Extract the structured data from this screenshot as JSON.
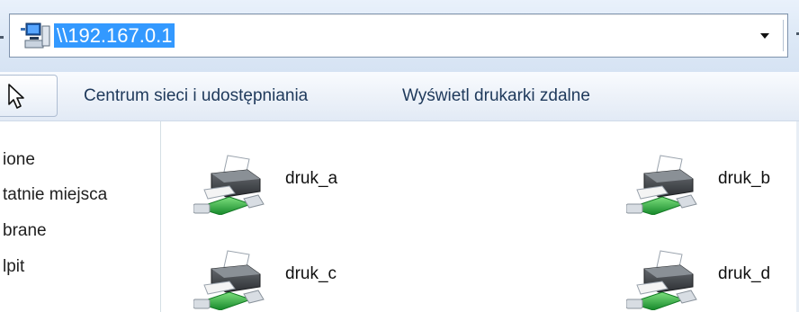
{
  "address_bar": {
    "path": "\\\\192.167.0.1",
    "location_icon": "computer-icon",
    "dropdown_icon": "chevron-down-icon"
  },
  "command_bar": {
    "tool_icon": "cursor-arrow-icon",
    "items": [
      {
        "label": "Centrum sieci i udostępniania"
      },
      {
        "label": "Wyświetl drukarki zdalne"
      }
    ]
  },
  "nav_pane": {
    "items": [
      {
        "label": "ione"
      },
      {
        "label": "tatnie miejsca"
      },
      {
        "label": "brane"
      },
      {
        "label": "lpit"
      }
    ]
  },
  "content": {
    "printers": [
      {
        "name": "druk_a",
        "icon": "network-printer-icon"
      },
      {
        "name": "druk_b",
        "icon": "network-printer-icon"
      },
      {
        "name": "druk_c",
        "icon": "network-printer-icon"
      },
      {
        "name": "druk_d",
        "icon": "network-printer-icon"
      }
    ]
  },
  "colors": {
    "selection": "#3399ff",
    "command_text": "#1e395b",
    "cable_green": "#2fae3c"
  }
}
